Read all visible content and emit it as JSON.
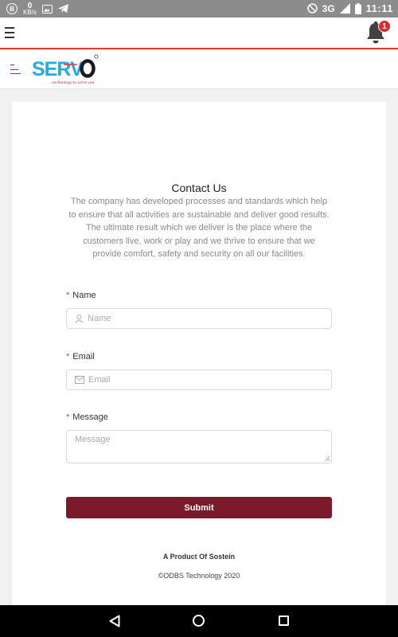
{
  "status_bar": {
    "icons": [
      "b-circle-icon",
      "data-speed-icon",
      "image-icon",
      "telegram-icon",
      "dnd-icon",
      "network-3g-icon",
      "signal-icon",
      "battery-icon"
    ],
    "speed_value": "0",
    "speed_unit": "KB/s",
    "network": "3G",
    "time": "11:11"
  },
  "header": {
    "notification_count": "1"
  },
  "brand": {
    "logo_text": "SERVO",
    "tagline": "...technology to serve you",
    "registered_mark": "®",
    "colors": {
      "blue": "#29a9e1",
      "dark": "#1a1a1a",
      "red": "#e53935"
    }
  },
  "contact": {
    "title": "Contact Us",
    "description": "The company has developed processes and standards which help to ensure that all activities are sustainable and deliver good results. The ultimate result which we deliver is the place where the customers live, work or play and we thrive to ensure that we provide comfort, safety and security on all our facilities.",
    "required_mark": "*",
    "name_label": "Name",
    "name_placeholder": "Name",
    "email_label": "Email",
    "email_placeholder": "Email",
    "message_label": "Message",
    "message_placeholder": "Message",
    "submit_label": "Submit"
  },
  "footer": {
    "product": "A Product Of Sostein",
    "copyright": "©ODBS Technology 2020"
  },
  "theme": {
    "submit_color": "#7b1a2a",
    "accent_red": "#e53935"
  }
}
